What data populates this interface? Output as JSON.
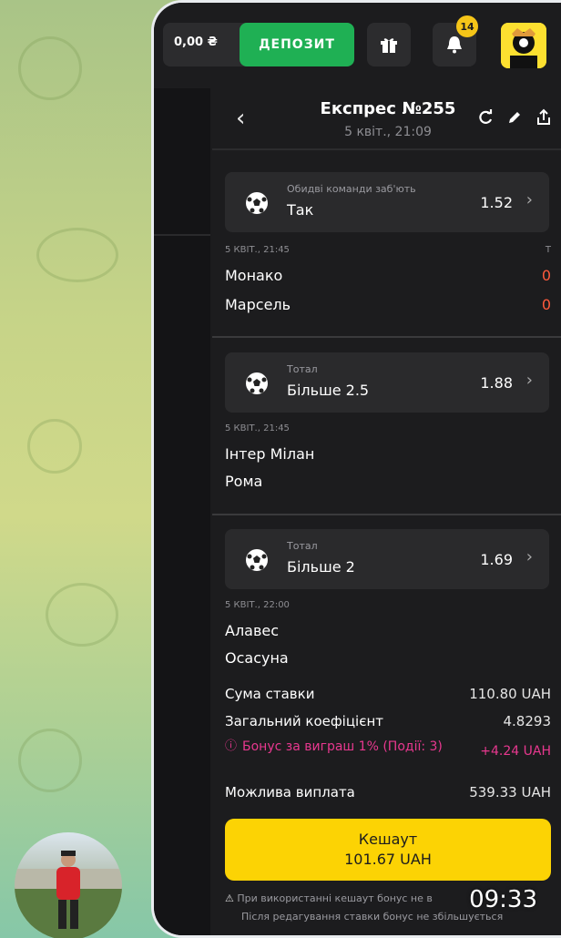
{
  "topbar": {
    "balance": "0,00 ₴",
    "deposit_label": "ДЕПОЗИТ",
    "notifications_count": "14",
    "icons": [
      "gift-icon",
      "bell-icon",
      "avatar"
    ]
  },
  "bet": {
    "title": "Експрес №255",
    "subtitle": "5 квіт., 21:09",
    "header_icons": [
      "back-icon",
      "refresh-icon",
      "edit-icon",
      "share-icon"
    ]
  },
  "events": [
    {
      "market": "Обидві команди заб'ють",
      "outcome": "Так",
      "odds": "1.52",
      "datetime": "5 КВІТ., 21:45",
      "score_header": "Т",
      "team1": "Монако",
      "team2": "Марсель",
      "score1": "0",
      "score2": "0"
    },
    {
      "market": "Тотал",
      "outcome": "Більше 2.5",
      "odds": "1.88",
      "datetime": "5 КВІТ., 21:45",
      "team1": "Інтер Мілан",
      "team2": "Рома"
    },
    {
      "market": "Тотал",
      "outcome": "Більше 2",
      "odds": "1.69",
      "datetime": "5 КВІТ., 22:00",
      "team1": "Алавес",
      "team2": "Осасуна"
    }
  ],
  "summary": {
    "stake_label": "Сума ставки",
    "stake_value": "110.80 UAH",
    "coef_label": "Загальний коефіцієнт",
    "coef_value": "4.8293",
    "bonus_label": "Бонус за виграш 1% (Події: 3)",
    "bonus_value": "+4.24 UAH",
    "payout_label": "Можлива виплата",
    "payout_value": "539.33 UAH",
    "cashout_label": "Кешаут",
    "cashout_value": "101.67 UAH",
    "note_line1": "При використанні кешаут бонус не в",
    "note_line2": "Після редагування ставки бонус не збільшується"
  },
  "overlay": {
    "time": "09:33"
  },
  "colors": {
    "accent_green": "#1fb054",
    "accent_yellow": "#fcd304",
    "bonus_pink": "#e8388f",
    "score_red": "#ff5a3c"
  }
}
